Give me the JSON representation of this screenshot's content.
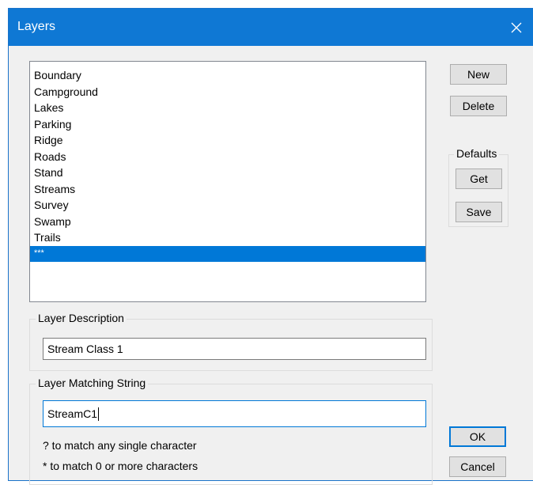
{
  "window": {
    "title": "Layers",
    "close_icon": "close-icon"
  },
  "layers": {
    "items": [
      {
        "label": "Boundary",
        "selected": false
      },
      {
        "label": "Campground",
        "selected": false
      },
      {
        "label": "Lakes",
        "selected": false
      },
      {
        "label": "Parking",
        "selected": false
      },
      {
        "label": "Ridge",
        "selected": false
      },
      {
        "label": "Roads",
        "selected": false
      },
      {
        "label": "Stand",
        "selected": false
      },
      {
        "label": "Streams",
        "selected": false
      },
      {
        "label": "Survey",
        "selected": false
      },
      {
        "label": "Swamp",
        "selected": false
      },
      {
        "label": "Trails",
        "selected": false
      },
      {
        "label": "***",
        "selected": true
      }
    ]
  },
  "buttons": {
    "new_label": "New",
    "delete_label": "Delete",
    "get_label": "Get",
    "save_label": "Save",
    "ok_label": "OK",
    "cancel_label": "Cancel"
  },
  "defaults": {
    "label": "Defaults"
  },
  "description": {
    "label": "Layer Description",
    "value": "Stream Class 1"
  },
  "matching": {
    "label": "Layer Matching String",
    "value": "StreamC1",
    "hint_single": "? to match any single character",
    "hint_multi": "* to match 0 or more characters"
  },
  "colors": {
    "accent": "#0078d7",
    "titlebar": "#0f78d4",
    "dialog_bg": "#f0f0f0"
  }
}
